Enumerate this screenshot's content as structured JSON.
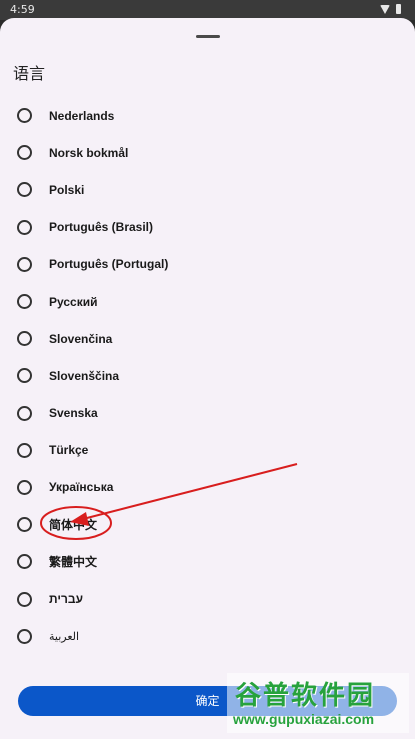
{
  "status_bar": {
    "time": "4:59",
    "icons": [
      "wifi-icon",
      "battery-icon"
    ]
  },
  "sheet": {
    "title": "语言",
    "options": [
      {
        "label": "Nederlands"
      },
      {
        "label": "Norsk bokmål"
      },
      {
        "label": "Polski"
      },
      {
        "label": "Português (Brasil)"
      },
      {
        "label": "Português (Portugal)"
      },
      {
        "label": "Русский"
      },
      {
        "label": "Slovenčina"
      },
      {
        "label": "Slovenščina"
      },
      {
        "label": "Svenska"
      },
      {
        "label": "Türkçe"
      },
      {
        "label": "Українська"
      },
      {
        "label": "简体中文"
      },
      {
        "label": "繁體中文"
      },
      {
        "label": "עברית"
      },
      {
        "label": "العربية"
      }
    ],
    "confirm_label": "确定"
  },
  "annotation": {
    "color": "#d81e1e"
  },
  "watermark": {
    "title": "谷普软件园",
    "url": "www.gupuxiazai.com"
  }
}
